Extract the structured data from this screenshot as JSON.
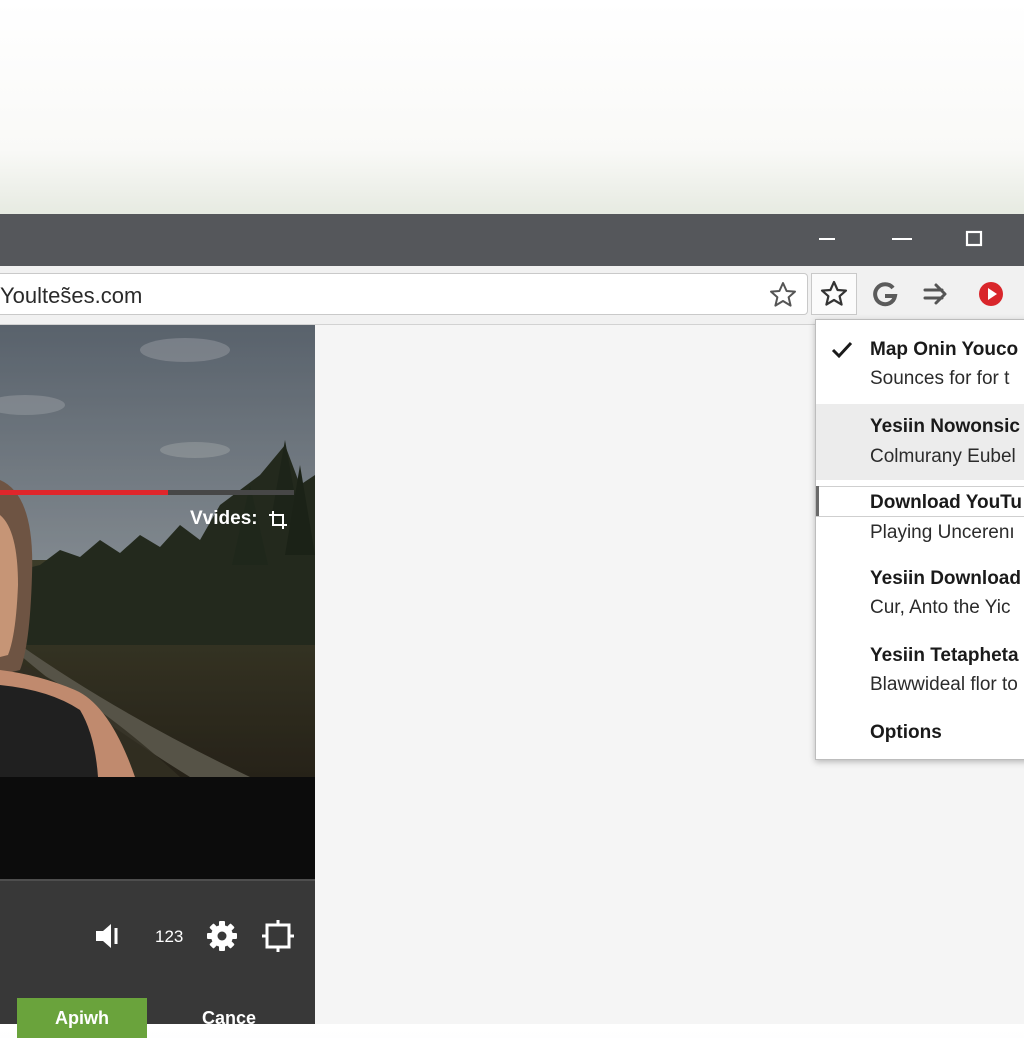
{
  "window": {
    "minimize_icon": "minimize-icon",
    "restore_icon": "restore-icon",
    "maximize_icon": "maximize-icon"
  },
  "toolbar": {
    "url": "Youltes̃es.com",
    "icons": [
      "star-outline-icon",
      "bookmark-star-icon",
      "google-g-icon",
      "arrow-forward-icon",
      "youtube-play-icon"
    ]
  },
  "colors": {
    "titlebar": "#55575b",
    "toolbar": "#f1f1f1",
    "progress": "#e0262b",
    "apply": "#6aa33c",
    "youtube_red": "#d9262b",
    "menu_highlight": "#ececec"
  },
  "player": {
    "progress_fraction": 0.57,
    "video_label": "Vvides:",
    "number_label": "123",
    "apply_label": "Apiwh",
    "cancel_label": "Cance",
    "icons": [
      "volume-icon",
      "gear-icon",
      "fullscreen-icon",
      "crop-icon"
    ]
  },
  "menu": {
    "items": [
      {
        "title": "Map Onin Youco",
        "subtitle": "Sounces for for t",
        "checked": true
      },
      {
        "title": "Yesiin Nowonsic",
        "subtitle": "Colmurany Eubel",
        "highlighted": true
      },
      {
        "title": "Download YouTu",
        "subtitle": "Playing Uncerenı",
        "focused": true
      },
      {
        "title": "Yesiin Download",
        "subtitle": "Cur, Anto the Yic"
      },
      {
        "title": "Yesiin Tetapheta",
        "subtitle": "Blawwideal flor to"
      },
      {
        "title": "Options"
      }
    ]
  }
}
